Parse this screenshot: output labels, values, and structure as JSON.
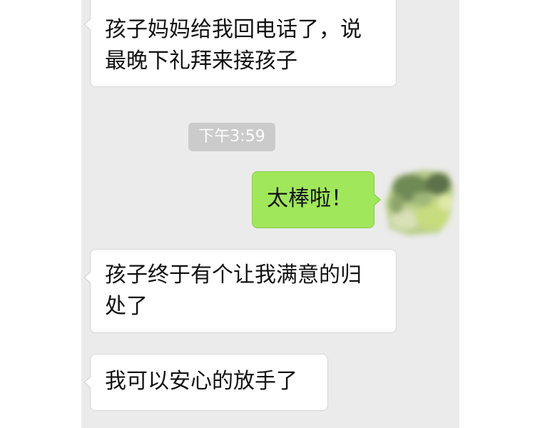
{
  "conversation": {
    "messages": [
      {
        "direction": "incoming",
        "lines": [
          "孩子妈妈给我回电话了，说",
          "最晚下礼拜来接孩子"
        ]
      },
      {
        "direction": "outgoing",
        "lines": [
          "太棒啦！"
        ]
      },
      {
        "direction": "incoming",
        "lines": [
          "孩子终于有个让我满意的归",
          "处了"
        ]
      },
      {
        "direction": "incoming",
        "lines": [
          "我可以安心的放手了"
        ]
      }
    ],
    "timestamp": "下午3:59"
  },
  "colors": {
    "chat_background": "#ebebeb",
    "incoming_bubble": "#ffffff",
    "outgoing_bubble": "#a0e75a",
    "timestamp_badge": "#cbcbcb"
  },
  "icons": {
    "self_avatar": "blurred-avatar-icon"
  }
}
